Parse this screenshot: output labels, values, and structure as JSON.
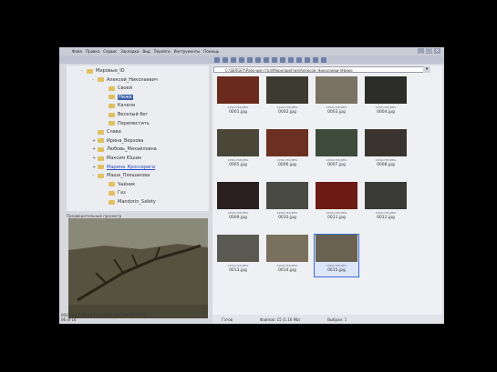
{
  "menubar": {
    "items": [
      "Файл",
      "Правка",
      "Сервис",
      "Закладки",
      "Вид",
      "Перейти",
      "Инструменты",
      "Помощь"
    ]
  },
  "tree": {
    "items": [
      {
        "label": "Мировые_ID",
        "level": 1,
        "expand": "-"
      },
      {
        "label": "Алексей_Николаевич",
        "level": 2,
        "expand": "-"
      },
      {
        "label": "Своей",
        "level": 3,
        "expand": ""
      },
      {
        "label": "Ниже",
        "level": 3,
        "expand": "",
        "selected": true
      },
      {
        "label": "Качели",
        "level": 3,
        "expand": ""
      },
      {
        "label": "Веселый бег",
        "level": 3,
        "expand": ""
      },
      {
        "label": "Переместить",
        "level": 3,
        "expand": ""
      },
      {
        "label": "Слава",
        "level": 2,
        "expand": ""
      },
      {
        "label": "Ирина_Верзова",
        "level": 2,
        "expand": "+"
      },
      {
        "label": "Любовь_Михайловна",
        "level": 2,
        "expand": "+"
      },
      {
        "label": "Максим Юшин",
        "level": 2,
        "expand": "+"
      },
      {
        "label": "Марина_Кроссвриги",
        "level": 2,
        "expand": "+",
        "link": true
      },
      {
        "label": "Маша_Плешакова",
        "level": 2,
        "expand": "-"
      },
      {
        "label": "Чайник",
        "level": 3,
        "expand": ""
      },
      {
        "label": "Газ",
        "level": 3,
        "expand": ""
      },
      {
        "label": "Mandorin_Safety",
        "level": 3,
        "expand": ""
      }
    ]
  },
  "preview": {
    "label": "Предварительный просмотр"
  },
  "status_left": {
    "line1": "0001.jpg 0.96 Kb   1100 JPEG   2011-04-18 12:05",
    "line2": "06 of 16"
  },
  "address": {
    "path": "C:\\SERGEY\\Рабочий стол\\Мероприятия\\Алексей_Николаевич\\Ниже"
  },
  "thumbs": [
    {
      "name": "0001.jpg",
      "meta": "1256x768 JPEG",
      "color": "#6a2a1c"
    },
    {
      "name": "0002.jpg",
      "meta": "1256x768 JPEG",
      "color": "#3d3a30"
    },
    {
      "name": "0003.jpg",
      "meta": "1256x768 JPEG",
      "color": "#7a7262"
    },
    {
      "name": "0004.jpg",
      "meta": "1256x768 JPEG",
      "color": "#2c2c28"
    },
    {
      "name": "0005.jpg",
      "meta": "1256x768 JPEG",
      "color": "#4a4638"
    },
    {
      "name": "0006.jpg",
      "meta": "1256x768 JPEG",
      "color": "#6b3020"
    },
    {
      "name": "0007.jpg",
      "meta": "1256x768 JPEG",
      "color": "#3e4a3a"
    },
    {
      "name": "0008.jpg",
      "meta": "1256x768 JPEG",
      "color": "#3a3430"
    },
    {
      "name": "0009.jpg",
      "meta": "1256x768 JPEG",
      "color": "#2a2020"
    },
    {
      "name": "0010.jpg",
      "meta": "1256x768 JPEG",
      "color": "#4a4a44"
    },
    {
      "name": "0011.jpg",
      "meta": "1256x768 JPEG",
      "color": "#6e1a14"
    },
    {
      "name": "0012.jpg",
      "meta": "1256x768 JPEG",
      "color": "#3a3a36"
    },
    {
      "name": "0013.jpg",
      "meta": "1256x768 JPEG",
      "color": "#5a5a52"
    },
    {
      "name": "0014.jpg",
      "meta": "1256x768 JPEG",
      "color": "#7a7060"
    },
    {
      "name": "0015.jpg",
      "meta": "1256x768 JPEG",
      "color": "#6a6250",
      "selected": true
    }
  ],
  "status_right": {
    "items": [
      "Готов",
      "Файлов: 15 (1.16 Mb)",
      "Выбран: 1"
    ]
  }
}
